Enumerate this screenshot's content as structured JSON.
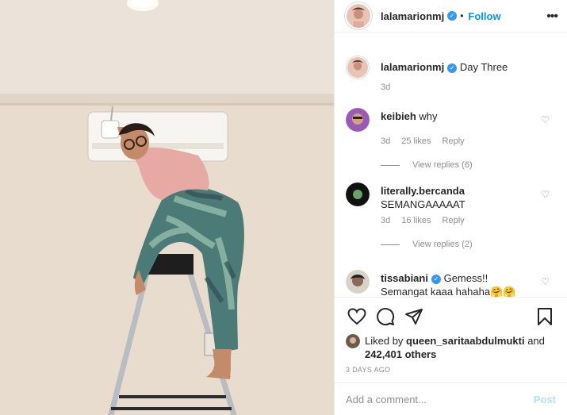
{
  "post": {
    "image_alt": "Woman climbing a ladder next to an air conditioner"
  },
  "header": {
    "username": "lalamarionmj",
    "separator": "•",
    "follow_label": "Follow",
    "more_icon": "more-horizontal-icon"
  },
  "caption": {
    "username": "lalamarionmj",
    "text": "Day Three",
    "time": "3d"
  },
  "comments": [
    {
      "username": "keibieh",
      "text": "why",
      "time": "3d",
      "likes": "25 likes",
      "reply_label": "Reply",
      "view_replies": "View replies (6)"
    },
    {
      "username": "literally.bercanda",
      "text": "SEMANGAAAAAT",
      "time": "3d",
      "likes": "16 likes",
      "reply_label": "Reply",
      "view_replies": "View replies (2)"
    },
    {
      "username": "tissabiani",
      "verified": true,
      "text": "Gemess!!",
      "text2": "Semangat kaaa hahaha",
      "emoji": "🤗🤗"
    }
  ],
  "actions": {
    "liked_by_prefix": "Liked by",
    "liked_by_user": "queen_saritaabdulmukti",
    "and": "and",
    "others": "242,401 others",
    "date": "3 DAYS AGO"
  },
  "add_comment": {
    "placeholder": "Add a comment...",
    "post_label": "Post"
  },
  "colors": {
    "accent": "#0095f6",
    "verified": "#3897f0",
    "muted": "#8e8e8e",
    "post_disabled": "#b2dffc"
  }
}
